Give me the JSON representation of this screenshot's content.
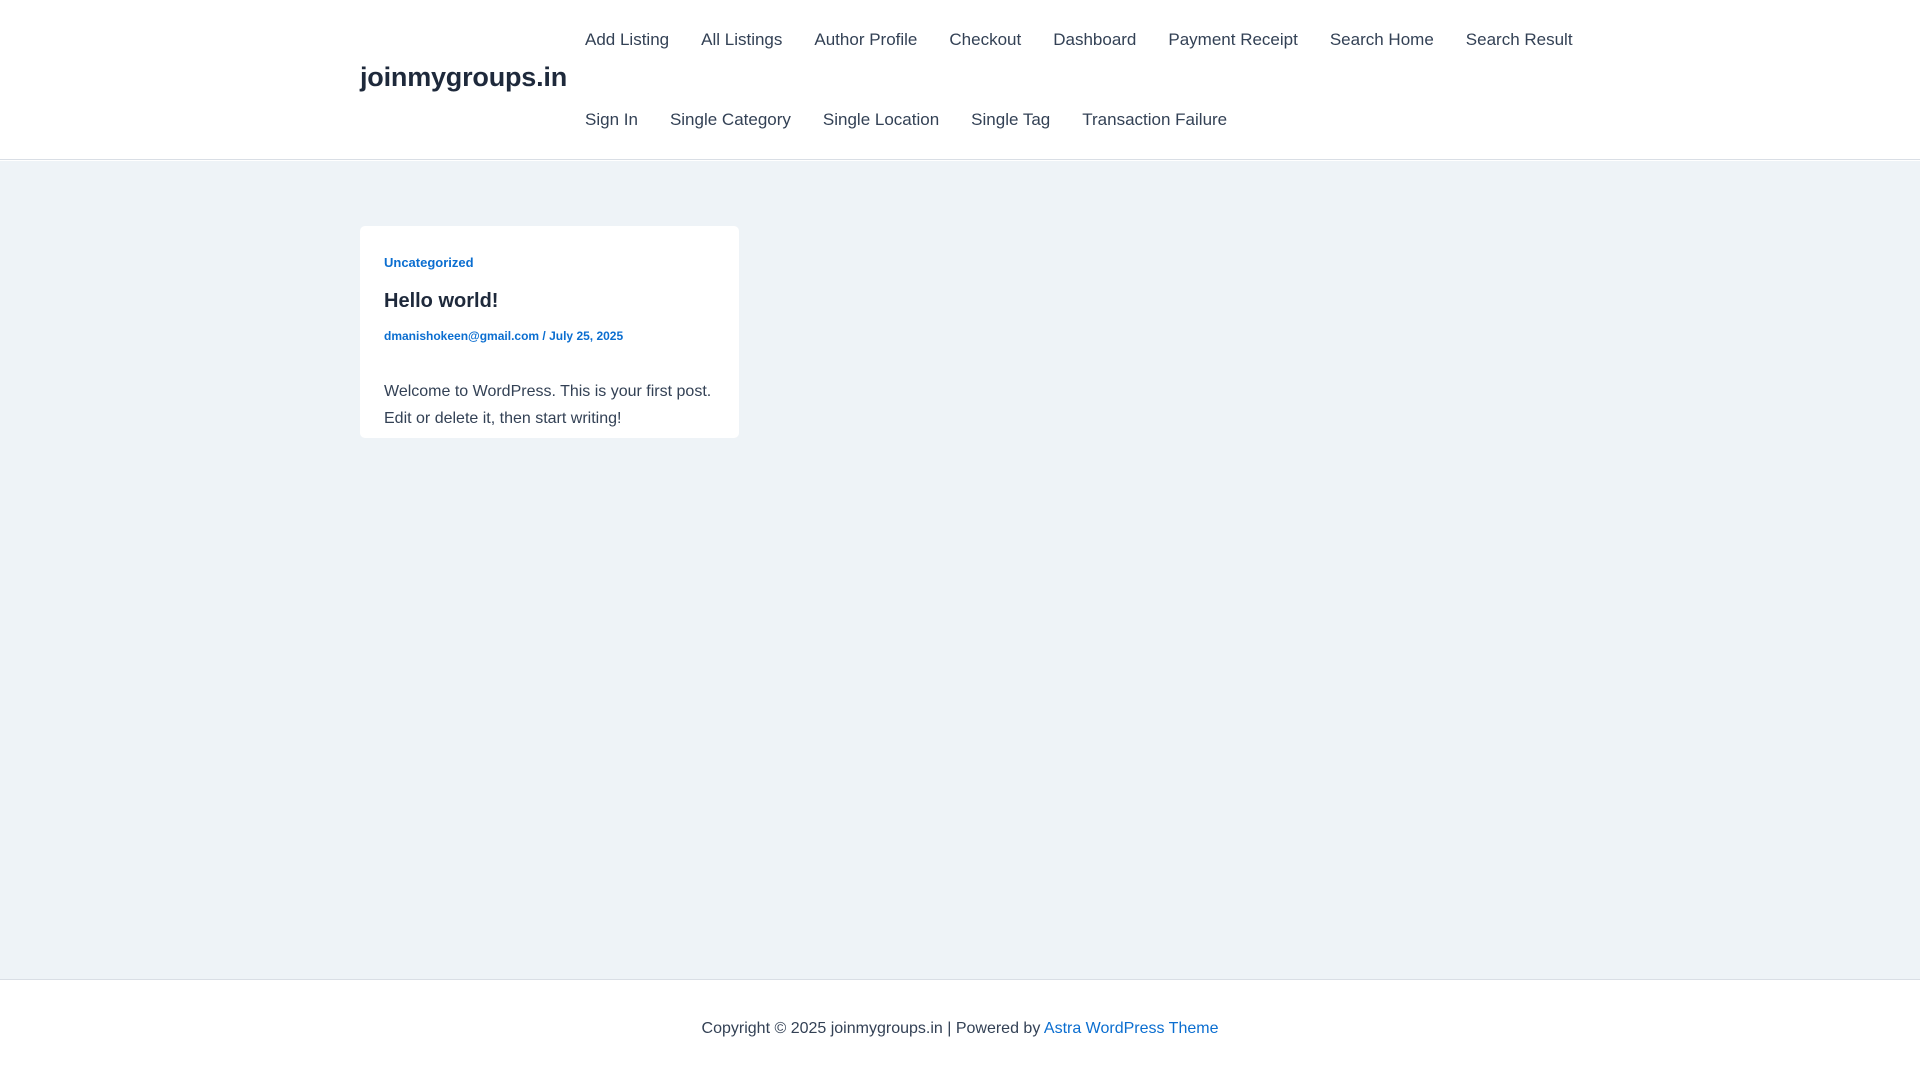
{
  "site": {
    "title": "joinmygroups.in"
  },
  "nav": {
    "row1": [
      "Add Listing",
      "All Listings",
      "Author Profile",
      "Checkout",
      "Dashboard",
      "Payment Receipt",
      "Search Home",
      "Search Result"
    ],
    "row2": [
      "Sign In",
      "Single Category",
      "Single Location",
      "Single Tag",
      "Transaction Failure"
    ]
  },
  "post": {
    "category": "Uncategorized",
    "title": "Hello world!",
    "author": "dmanishokeen@gmail.com",
    "separator": " / ",
    "date": "July 25, 2025",
    "excerpt": "Welcome to WordPress. This is your first post. Edit or delete it, then start writing!"
  },
  "footer": {
    "copyright": "Copyright © 2025 joinmygroups.in | Powered by ",
    "theme_link": "Astra WordPress Theme"
  },
  "colors": {
    "accent": "#0b6ed0",
    "content_bg": "#eef3f7",
    "heading": "#1e293b",
    "text": "#334155"
  }
}
